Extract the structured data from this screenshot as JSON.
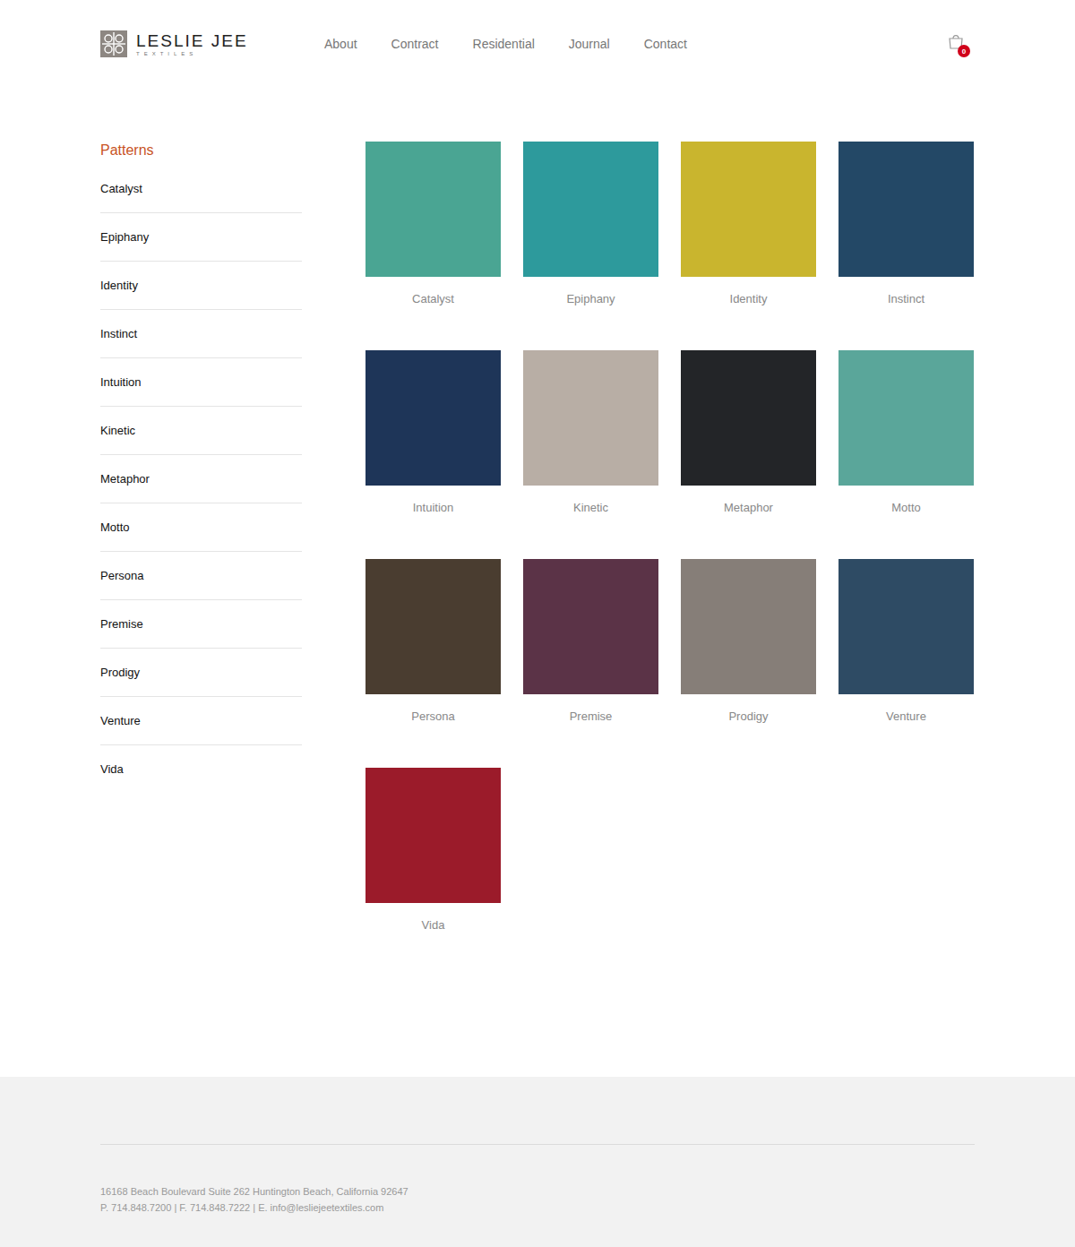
{
  "header": {
    "logo": {
      "name": "LESLIE JEE",
      "tagline": "TEXTILES"
    },
    "nav": [
      "About",
      "Contract",
      "Residential",
      "Journal",
      "Contact"
    ],
    "cart": {
      "count": "0"
    }
  },
  "sidebar": {
    "title": "Patterns",
    "items": [
      "Catalyst",
      "Epiphany",
      "Identity",
      "Instinct",
      "Intuition",
      "Kinetic",
      "Metaphor",
      "Motto",
      "Persona",
      "Premise",
      "Prodigy",
      "Venture",
      "Vida"
    ]
  },
  "grid": {
    "items": [
      {
        "name": "Catalyst",
        "color": "#4aa593"
      },
      {
        "name": "Epiphany",
        "color": "#2d9a9c"
      },
      {
        "name": "Identity",
        "color": "#c9b52e"
      },
      {
        "name": "Instinct",
        "color": "#234866"
      },
      {
        "name": "Intuition",
        "color": "#1e3558"
      },
      {
        "name": "Kinetic",
        "color": "#b8aea5"
      },
      {
        "name": "Metaphor",
        "color": "#232528"
      },
      {
        "name": "Motto",
        "color": "#5aa69a"
      },
      {
        "name": "Persona",
        "color": "#4a3d30"
      },
      {
        "name": "Premise",
        "color": "#5b3347"
      },
      {
        "name": "Prodigy",
        "color": "#867e78"
      },
      {
        "name": "Venture",
        "color": "#2e4b64"
      },
      {
        "name": "Vida",
        "color": "#9b1b2a"
      }
    ]
  },
  "footer": {
    "address": "16168 Beach Boulevard Suite 262 Huntington Beach, California 92647",
    "contact": "P. 714.848.7200 | F. 714.848.7222 | E. info@lesliejeetextiles.com"
  }
}
